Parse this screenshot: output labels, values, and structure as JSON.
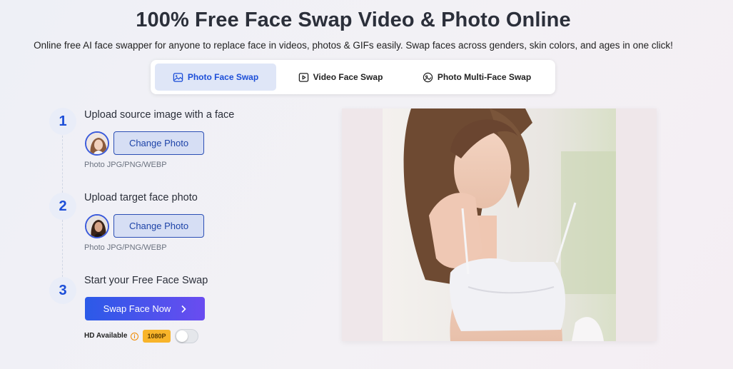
{
  "header": {
    "title": "100% Free Face Swap Video & Photo Online",
    "subtitle": "Online free AI face swapper for anyone to replace face in videos, photos & GIFs easily. Swap faces across genders, skin colors, and ages in one click!"
  },
  "tabs": [
    {
      "label": "Photo Face Swap",
      "icon": "image-icon",
      "active": true
    },
    {
      "label": "Video Face Swap",
      "icon": "video-icon",
      "active": false
    },
    {
      "label": "Photo Multi-Face Swap",
      "icon": "multi-face-icon",
      "active": false
    }
  ],
  "steps": [
    {
      "number": "1",
      "title": "Upload source image with a face",
      "button": "Change Photo",
      "hint": "Photo JPG/PNG/WEBP"
    },
    {
      "number": "2",
      "title": "Upload target face photo",
      "button": "Change Photo",
      "hint": "Photo JPG/PNG/WEBP"
    },
    {
      "number": "3",
      "title": "Start your Free Face Swap"
    }
  ],
  "swap": {
    "button_label": "Swap Face Now",
    "hd_label": "HD Available",
    "hd_badge": "1080P",
    "hd_enabled": false
  },
  "colors": {
    "accent": "#1c4ed8",
    "gradient_start": "#2b5ae8",
    "gradient_end": "#6a4cf0",
    "badge": "#f8b42a"
  }
}
